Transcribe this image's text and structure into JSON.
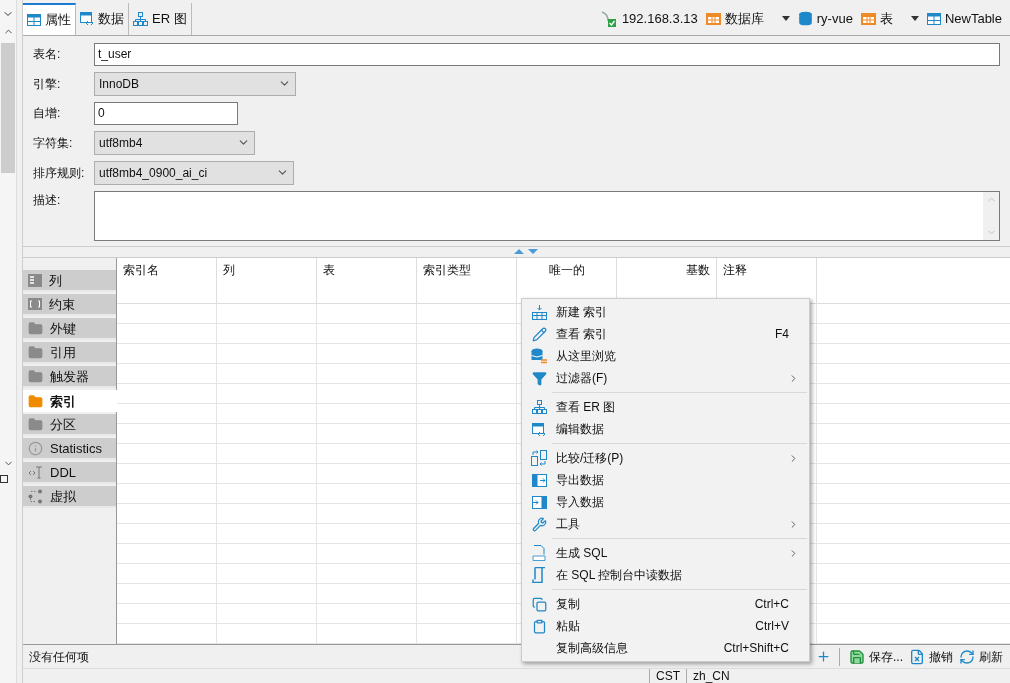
{
  "tabs": [
    {
      "label": "属性",
      "selected": true
    },
    {
      "label": "数据",
      "selected": false
    },
    {
      "label": "ER 图",
      "selected": false
    }
  ],
  "breadcrumb": [
    {
      "label": "192.168.3.13",
      "dropdown": false
    },
    {
      "label": "数据库",
      "dropdown": true
    },
    {
      "label": "ry-vue",
      "dropdown": false
    },
    {
      "label": "表",
      "dropdown": true
    },
    {
      "label": "NewTable",
      "dropdown": false
    }
  ],
  "form": [
    {
      "label": "表名:",
      "kind": "text",
      "value": "t_user"
    },
    {
      "label": "引擎:",
      "kind": "select",
      "value": "InnoDB"
    },
    {
      "label": "自增:",
      "kind": "text",
      "value": "0"
    },
    {
      "label": "字符集:",
      "kind": "select",
      "value": "utf8mb4"
    },
    {
      "label": "排序规则:",
      "kind": "select",
      "value": "utf8mb4_0900_ai_ci"
    },
    {
      "label": "描述:",
      "kind": "textarea"
    }
  ],
  "side_tabs": [
    {
      "label": "列",
      "selected": false
    },
    {
      "label": "约束",
      "selected": false
    },
    {
      "label": "外键",
      "selected": false
    },
    {
      "label": "引用",
      "selected": false
    },
    {
      "label": "触发器",
      "selected": false
    },
    {
      "label": "索引",
      "selected": true
    },
    {
      "label": "分区",
      "selected": false
    },
    {
      "label": "Statistics",
      "selected": false
    },
    {
      "label": "DDL",
      "selected": false
    },
    {
      "label": "虚拟",
      "selected": false
    }
  ],
  "table": {
    "columns": [
      "索引名",
      "列",
      "表",
      "索引类型",
      "唯一的",
      "基数",
      "注释"
    ]
  },
  "status": "没有任何项",
  "toolbar": [
    "保存...",
    "撤销",
    "刷新"
  ],
  "context_menu": [
    {
      "kind": "item",
      "label": "新建 索引"
    },
    {
      "kind": "item",
      "label": "查看 索引",
      "shortcut": "F4"
    },
    {
      "kind": "item",
      "label": "从这里浏览"
    },
    {
      "kind": "item",
      "label": "过滤器(F)",
      "submenu": true
    },
    {
      "kind": "separator"
    },
    {
      "kind": "item",
      "label": "查看 ER 图"
    },
    {
      "kind": "item",
      "label": "编辑数据"
    },
    {
      "kind": "separator"
    },
    {
      "kind": "item",
      "label": "比较/迁移(P)",
      "submenu": true
    },
    {
      "kind": "item",
      "label": "导出数据"
    },
    {
      "kind": "item",
      "label": "导入数据"
    },
    {
      "kind": "item",
      "label": "工具",
      "submenu": true
    },
    {
      "kind": "separator"
    },
    {
      "kind": "item",
      "label": "生成 SQL",
      "submenu": true
    },
    {
      "kind": "item",
      "label": "在 SQL 控制台中读数据"
    },
    {
      "kind": "separator"
    },
    {
      "kind": "item",
      "label": "复制",
      "shortcut": "Ctrl+C"
    },
    {
      "kind": "item",
      "label": "粘贴",
      "shortcut": "Ctrl+V"
    },
    {
      "kind": "item",
      "label": "复制高级信息",
      "shortcut": "Ctrl+Shift+C"
    }
  ],
  "status_bar": [
    "CST",
    "zh_CN"
  ]
}
